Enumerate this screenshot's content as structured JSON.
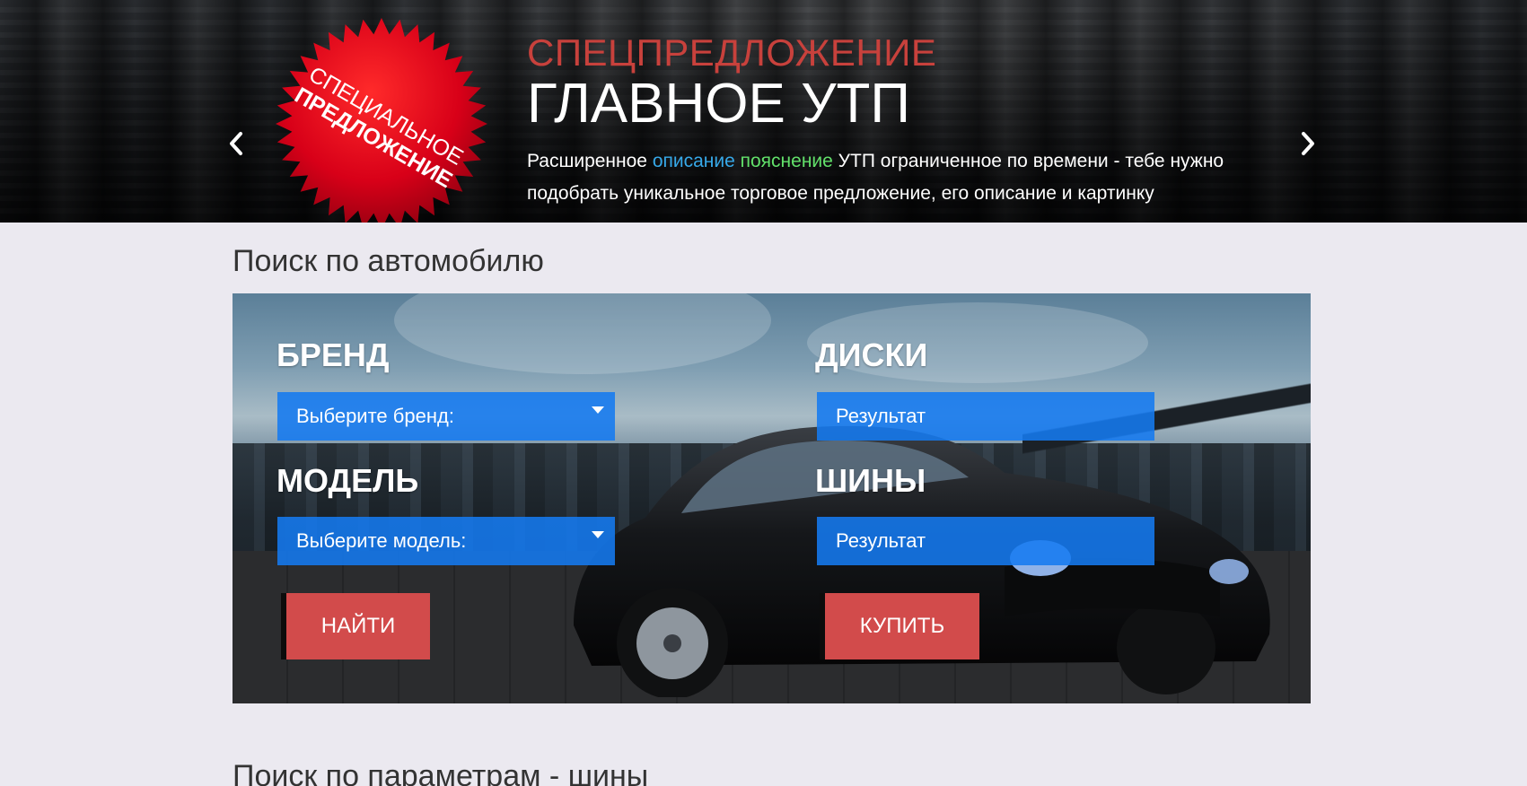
{
  "hero": {
    "badge_line1": "СПЕЦИАЛЬНОЕ",
    "badge_line2": "ПРЕДЛОЖЕНИЕ",
    "kicker": "СПЕЦПРЕДЛОЖЕНИЕ",
    "title": "ГЛАВНОЕ УТП",
    "desc_part1": "Расширенное ",
    "desc_highlight_blue": "описание",
    "desc_space": " ",
    "desc_highlight_green": "пояснение",
    "desc_part2": " УТП ограниченное по времени - тебе нужно подобрать уникальное торговое предложение, его описание и картинку",
    "prev_icon": "chevron-left-icon",
    "next_icon": "chevron-right-icon",
    "colors": {
      "kicker": "#c8413c",
      "blue": "#36a8e8",
      "green": "#62e06a",
      "badge": "#d80018"
    }
  },
  "car_search": {
    "title": "Поиск по автомобилю",
    "brand_label": "БРЕНД",
    "brand_placeholder": "Выберите бренд:",
    "model_label": "МОДЕЛЬ",
    "model_placeholder": "Выберите модель:",
    "disks_label": "ДИСКИ",
    "disks_result": "Результат",
    "tires_label": "ШИНЫ",
    "tires_result": "Результат",
    "find_button": "НАЙТИ",
    "buy_button": "КУПИТЬ",
    "colors": {
      "field": "#147af0",
      "button": "#d24b4b"
    }
  },
  "params_search": {
    "title": "Поиск по параметрам - шины"
  }
}
